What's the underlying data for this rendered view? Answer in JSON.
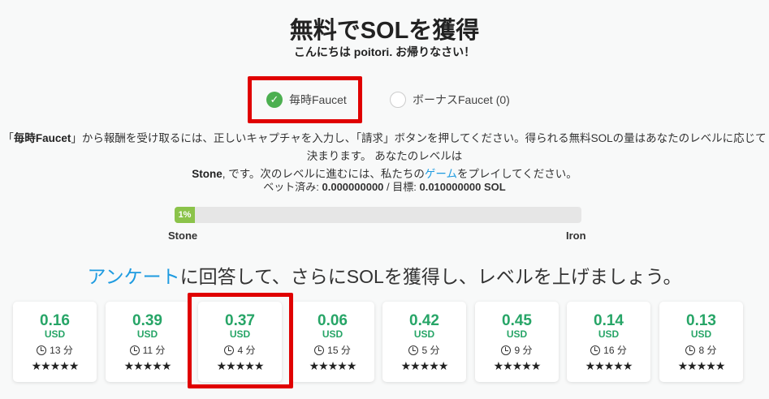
{
  "title": "無料でSOLを獲得",
  "greeting": "こんにちは poitori. お帰りなさい！",
  "tabs": [
    {
      "label": "毎時Faucet",
      "selected": true
    },
    {
      "label": "ボーナスFaucet (0)",
      "selected": false
    }
  ],
  "description": {
    "p1": "「",
    "bold1": "毎時Faucet",
    "p2": "」から報酬を受け取るには、正しいキャプチャを入力し、「請求」ボタンを押してください。得られる無料SOLの量はあなたのレベルに応じて決まります。 あなたのレベルは ",
    "level": "Stone",
    "p3": ", です。次のレベルに進むには、私たちの",
    "link": "ゲーム",
    "p4": "をプレイしてください。"
  },
  "bet": {
    "label": "ベット済み: ",
    "value": "0.000000000",
    "sep": " / 目標: ",
    "target": "0.010000000 SOL"
  },
  "progress": {
    "percent": 1,
    "label": "1%",
    "from": "Stone",
    "to": "Iron"
  },
  "survey": {
    "link": "アンケート",
    "text": "に回答して、さらにSOLを獲得し、レベルを上げましょう。"
  },
  "offers": [
    {
      "amount": "0.16",
      "currency": "USD",
      "time": "13 分",
      "stars": "★★★★★"
    },
    {
      "amount": "0.39",
      "currency": "USD",
      "time": "11 分",
      "stars": "★★★★★"
    },
    {
      "amount": "0.37",
      "currency": "USD",
      "time": "4 分",
      "stars": "★★★★★"
    },
    {
      "amount": "0.06",
      "currency": "USD",
      "time": "15 分",
      "stars": "★★★★★"
    },
    {
      "amount": "0.42",
      "currency": "USD",
      "time": "5 分",
      "stars": "★★★★★"
    },
    {
      "amount": "0.45",
      "currency": "USD",
      "time": "9 分",
      "stars": "★★★★★"
    },
    {
      "amount": "0.14",
      "currency": "USD",
      "time": "16 分",
      "stars": "★★★★★"
    },
    {
      "amount": "0.13",
      "currency": "USD",
      "time": "8 分",
      "stars": "★★★★★"
    }
  ],
  "colors": {
    "highlight": "#e00000",
    "green": "#27a567",
    "link": "#1e9be0"
  }
}
